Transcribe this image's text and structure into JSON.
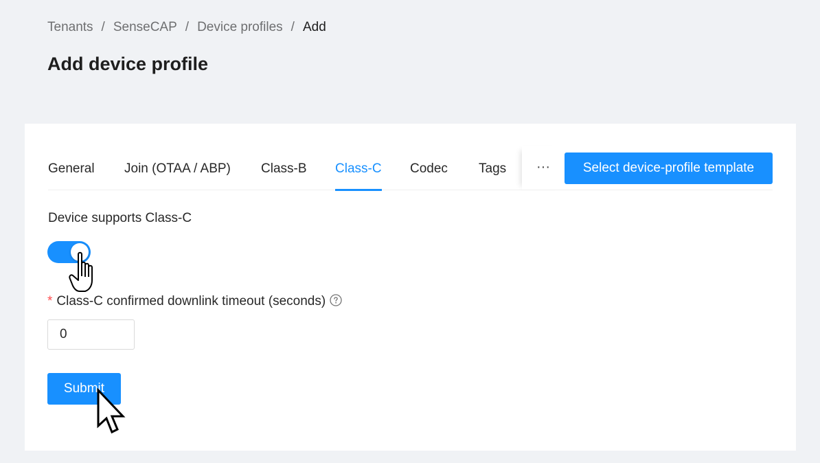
{
  "breadcrumb": {
    "items": [
      "Tenants",
      "SenseCAP",
      "Device profiles",
      "Add"
    ],
    "separator": "/"
  },
  "page": {
    "title": "Add device profile"
  },
  "tabs": {
    "items": [
      {
        "label": "General"
      },
      {
        "label": "Join (OTAA / ABP)"
      },
      {
        "label": "Class-B"
      },
      {
        "label": "Class-C",
        "active": true
      },
      {
        "label": "Codec"
      },
      {
        "label": "Tags"
      }
    ],
    "more_label": "···",
    "template_button": "Select device-profile template"
  },
  "form": {
    "class_c_support": {
      "label": "Device supports Class-C",
      "checked": true
    },
    "timeout": {
      "required_mark": "*",
      "label": "Class-C confirmed downlink timeout (seconds)",
      "value": "0",
      "help_icon": "question-circle-icon"
    },
    "submit_label": "Submit"
  },
  "colors": {
    "primary": "#1890ff",
    "required": "#ff4d4f",
    "background": "#f0f2f5"
  },
  "cursors": [
    "hand-pointer-icon",
    "arrow-pointer-icon"
  ]
}
